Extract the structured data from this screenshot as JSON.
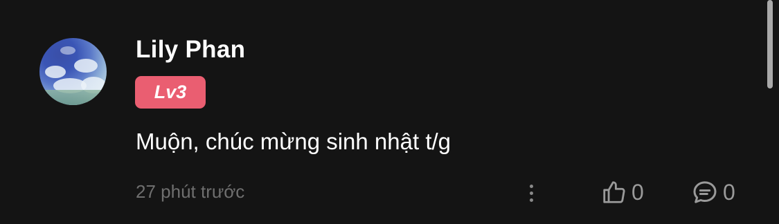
{
  "comment": {
    "author": "Lily Phan",
    "level": "Lv3",
    "text": "Muộn, chúc mừng sinh nhật t/g",
    "timestamp": "27 phút trước",
    "like_count": "0",
    "reply_count": "0"
  },
  "colors": {
    "background": "#141414",
    "level_badge": "#ea5e71",
    "muted_text": "#6f6f6f",
    "icon": "#9a9a9a"
  },
  "icons": {
    "more": "more-vertical-icon",
    "like": "thumbs-up-icon",
    "reply": "comment-bubble-icon"
  }
}
